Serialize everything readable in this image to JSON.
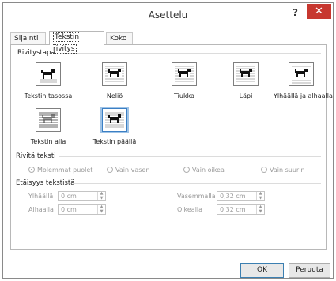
{
  "dialog": {
    "title": "Asettelu",
    "help_label": "?",
    "close_label": "✕"
  },
  "tabs": [
    {
      "label": "Sijainti",
      "active": false
    },
    {
      "label": "Tekstin rivitys",
      "active": true
    },
    {
      "label": "Koko",
      "active": false
    }
  ],
  "wrapping_style": {
    "heading": "Rivitystapa",
    "options": [
      {
        "label": "Tekstin tasossa",
        "icon": "in-line-with-text-icon",
        "selected": false
      },
      {
        "label": "Neliö",
        "icon": "square-wrap-icon",
        "selected": false
      },
      {
        "label": "Tiukka",
        "icon": "tight-wrap-icon",
        "selected": false
      },
      {
        "label": "Läpi",
        "icon": "through-wrap-icon",
        "selected": false
      },
      {
        "label": "Ylhäällä ja alhaalla",
        "icon": "top-and-bottom-icon",
        "selected": false
      },
      {
        "label": "Tekstin alla",
        "icon": "behind-text-icon",
        "selected": false
      },
      {
        "label": "Tekstin päällä",
        "icon": "in-front-of-text-icon",
        "selected": true
      }
    ]
  },
  "wrap_text": {
    "heading": "Rivitä teksti",
    "options": [
      {
        "label": "Molemmat puolet",
        "selected": true
      },
      {
        "label": "Vain vasen",
        "selected": false
      },
      {
        "label": "Vain oikea",
        "selected": false
      },
      {
        "label": "Vain suurin",
        "selected": false
      }
    ]
  },
  "distance": {
    "heading": "Etäisyys tekstistä",
    "top_label": "Ylhäällä",
    "top_value": "0 cm",
    "bottom_label": "Alhaalla",
    "bottom_value": "0 cm",
    "left_label": "Vasemmalla",
    "left_value": "0,32 cm",
    "right_label": "Oikealla",
    "right_value": "0,32 cm"
  },
  "buttons": {
    "ok": "OK",
    "cancel": "Peruuta"
  },
  "colors": {
    "close_button": "#c7372f",
    "selection_border": "#3b7fc4",
    "disabled_text": "#9a9a9a"
  }
}
